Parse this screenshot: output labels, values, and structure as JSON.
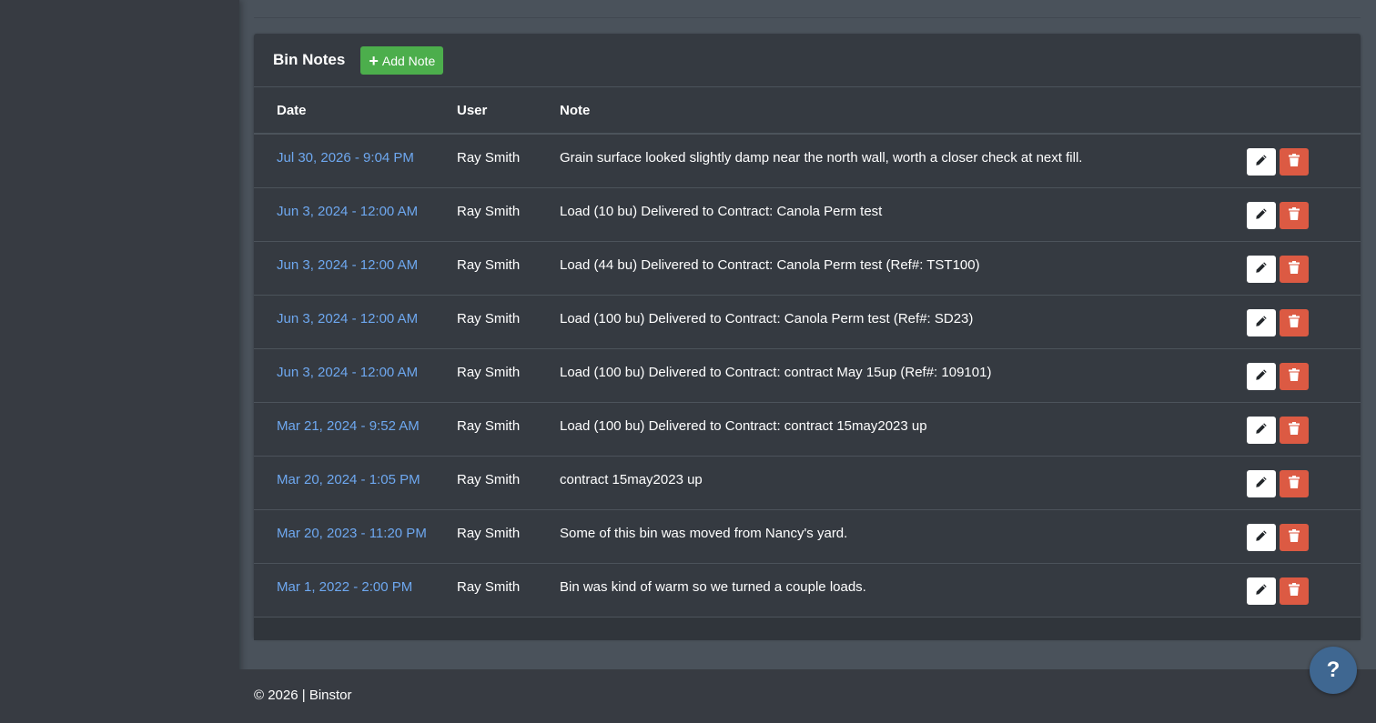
{
  "card": {
    "title": "Bin Notes",
    "add_button_label": "Add Note"
  },
  "table": {
    "headers": {
      "date": "Date",
      "user": "User",
      "note": "Note"
    },
    "rows": [
      {
        "date": "Jul 30, 2026 - 9:04 PM",
        "user": "Ray Smith",
        "note": "Grain surface looked slightly damp near the north wall, worth a closer check at next fill."
      },
      {
        "date": "Jun 3, 2024 - 12:00 AM",
        "user": "Ray Smith",
        "note": "Load (10 bu) Delivered to Contract: Canola Perm test"
      },
      {
        "date": "Jun 3, 2024 - 12:00 AM",
        "user": "Ray Smith",
        "note": "Load (44 bu) Delivered to Contract: Canola Perm test (Ref#: TST100)"
      },
      {
        "date": "Jun 3, 2024 - 12:00 AM",
        "user": "Ray Smith",
        "note": "Load (100 bu) Delivered to Contract: Canola Perm test (Ref#: SD23)"
      },
      {
        "date": "Jun 3, 2024 - 12:00 AM",
        "user": "Ray Smith",
        "note": "Load (100 bu) Delivered to Contract: contract May 15up (Ref#: 109101)"
      },
      {
        "date": "Mar 21, 2024 - 9:52 AM",
        "user": "Ray Smith",
        "note": "Load (100 bu) Delivered to Contract: contract 15may2023 up"
      },
      {
        "date": "Mar 20, 2024 - 1:05 PM",
        "user": "Ray Smith",
        "note": "contract 15may2023 up"
      },
      {
        "date": "Mar 20, 2023 - 11:20 PM",
        "user": "Ray Smith",
        "note": "Some of this bin was moved from Nancy's yard."
      },
      {
        "date": "Mar 1, 2022 - 2:00 PM",
        "user": "Ray Smith",
        "note": "Bin was kind of warm so we turned a couple loads."
      }
    ]
  },
  "icons": {
    "add": "plus-icon",
    "edit": "pencil-icon",
    "delete": "trash-icon",
    "help": "question-icon"
  },
  "footer": {
    "text": "© 2026 | Binstor"
  },
  "help": {
    "label": "?"
  },
  "colors": {
    "add_button": "#4cae4c",
    "delete_button": "#dc5a43",
    "date_link": "#6ea8f0",
    "help_button": "#3f6791"
  }
}
